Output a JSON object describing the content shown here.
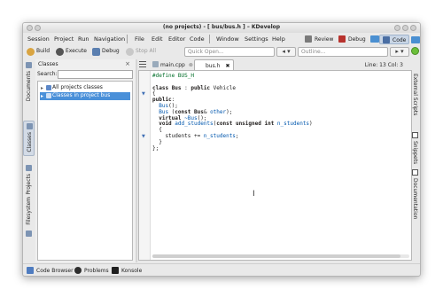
{
  "window": {
    "title": "(no projects) - [ bus/bus.h ] – KDevelop"
  },
  "menubar": {
    "items": [
      {
        "label": "Session"
      },
      {
        "label": "Project"
      },
      {
        "label": "Run"
      },
      {
        "label": "Navigation"
      },
      {
        "label": "File"
      },
      {
        "label": "Edit"
      },
      {
        "label": "Editor"
      },
      {
        "label": "Code"
      },
      {
        "label": "Window"
      },
      {
        "label": "Settings"
      },
      {
        "label": "Help"
      }
    ],
    "areas": [
      {
        "label": "Review"
      },
      {
        "label": "Debug"
      },
      {
        "label": "Code"
      }
    ]
  },
  "toolbar": {
    "build": "Build",
    "execute": "Execute",
    "debug": "Debug",
    "stop_all": "Stop All",
    "quick_open_placeholder": "Quick Open...",
    "outline_placeholder": "Outline..."
  },
  "left_tabs": [
    {
      "label": "Documents"
    },
    {
      "label": "Classes"
    },
    {
      "label": "Projects"
    },
    {
      "label": "Filesystem"
    }
  ],
  "classes_panel": {
    "title": "Classes",
    "search_label": "Search:",
    "items": [
      {
        "label": "All projects classes"
      },
      {
        "label": "Classes in project bus"
      }
    ]
  },
  "doc_tabs": [
    {
      "label": "main.cpp"
    },
    {
      "label": "bus.h"
    }
  ],
  "cursor_position": "Line: 13 Col: 3",
  "editor": {
    "lines": [
      [
        {
          "t": "#define BUS_H",
          "c": "pre"
        }
      ],
      [],
      [
        {
          "t": "class ",
          "c": "kw"
        },
        {
          "t": "Bus",
          "c": "kw"
        },
        {
          "t": " : ",
          "c": "plain"
        },
        {
          "t": "public ",
          "c": "kw"
        },
        {
          "t": "Vehicle",
          "c": "plain"
        }
      ],
      [
        {
          "t": "{",
          "c": "plain"
        }
      ],
      [
        {
          "t": "public",
          "c": "kw"
        },
        {
          "t": ":",
          "c": "plain"
        }
      ],
      [
        {
          "t": "  Bus",
          "c": "type"
        },
        {
          "t": "();",
          "c": "plain"
        }
      ],
      [
        {
          "t": "  Bus",
          "c": "type"
        },
        {
          "t": " (",
          "c": "plain"
        },
        {
          "t": "const ",
          "c": "kw"
        },
        {
          "t": "Bus",
          "c": "kw"
        },
        {
          "t": "& ",
          "c": "plain"
        },
        {
          "t": "other",
          "c": "var"
        },
        {
          "t": ");",
          "c": "plain"
        }
      ],
      [
        {
          "t": "  virtual ",
          "c": "kw"
        },
        {
          "t": "~Bus",
          "c": "type"
        },
        {
          "t": "();",
          "c": "plain"
        }
      ],
      [
        {
          "t": "  void ",
          "c": "kw"
        },
        {
          "t": "add_students",
          "c": "type"
        },
        {
          "t": "(",
          "c": "plain"
        },
        {
          "t": "const unsigned int ",
          "c": "kw"
        },
        {
          "t": "n_students",
          "c": "var"
        },
        {
          "t": ")",
          "c": "plain"
        }
      ],
      [
        {
          "t": "  {",
          "c": "plain"
        }
      ],
      [
        {
          "t": "    students += ",
          "c": "plain"
        },
        {
          "t": "n_students",
          "c": "var"
        },
        {
          "t": ";",
          "c": "plain"
        }
      ],
      [
        {
          "t": "  }",
          "c": "plain"
        }
      ],
      [
        {
          "t": "};",
          "c": "plain"
        }
      ]
    ]
  },
  "right_tabs": [
    {
      "label": "External Scripts"
    },
    {
      "label": "Snippets"
    },
    {
      "label": "Documentation"
    }
  ],
  "bottom_tabs": [
    {
      "label": "Code Browser"
    },
    {
      "label": "Problems"
    },
    {
      "label": "Konsole"
    }
  ]
}
